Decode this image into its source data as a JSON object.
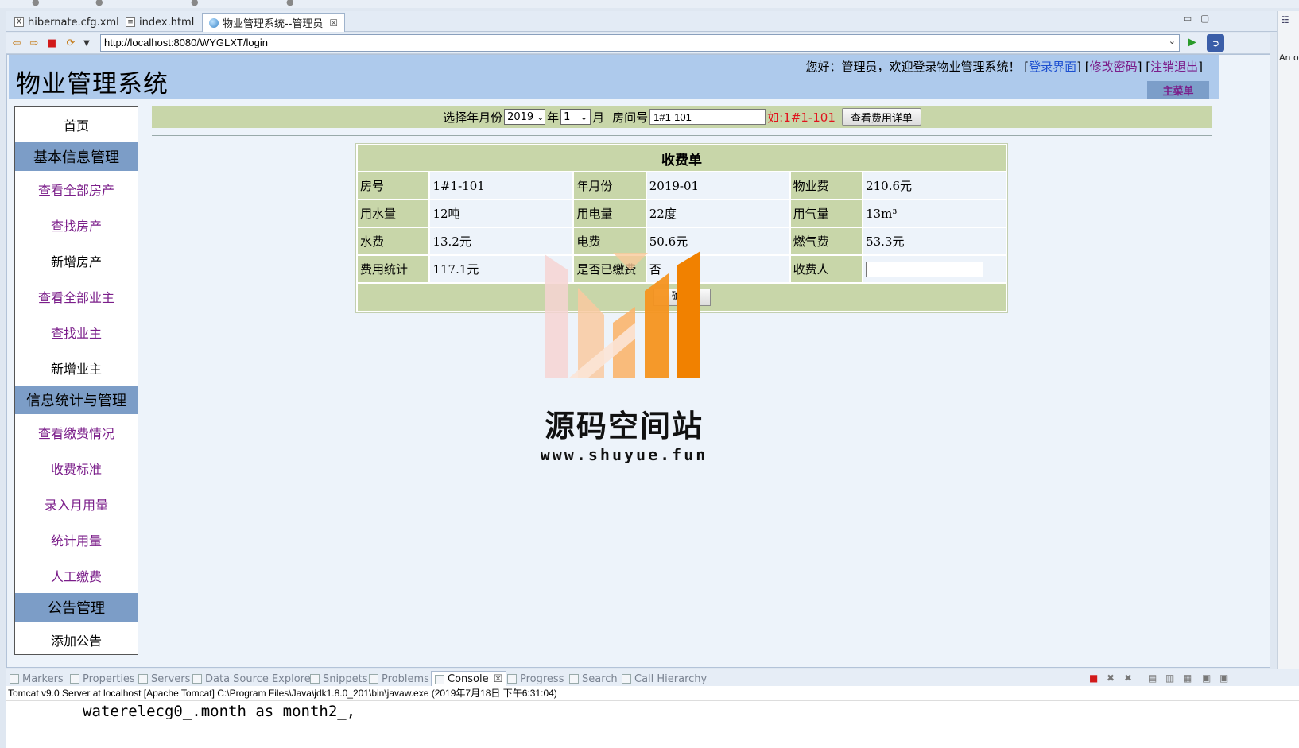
{
  "ide": {
    "editor_tabs": [
      {
        "label": "hibernate.cfg.xml",
        "icon": "xml-file-icon"
      },
      {
        "label": "index.html",
        "icon": "html-file-icon"
      },
      {
        "label": "物业管理系统--管理员",
        "icon": "globe-icon",
        "active": true
      }
    ],
    "right_gutter_text": "An o",
    "bottom_tabs": [
      {
        "label": "Markers"
      },
      {
        "label": "Properties"
      },
      {
        "label": "Servers"
      },
      {
        "label": "Data Source Explorer"
      },
      {
        "label": "Snippets"
      },
      {
        "label": "Problems"
      },
      {
        "label": "Console",
        "active": true
      },
      {
        "label": "Progress"
      },
      {
        "label": "Search"
      },
      {
        "label": "Call Hierarchy"
      }
    ],
    "console_status": "Tomcat v9.0 Server at localhost [Apache Tomcat] C:\\Program Files\\Java\\jdk1.8.0_201\\bin\\javaw.exe (2019年7月18日 下午6:31:04)",
    "console_line": "waterelecg0_.month as month2_,"
  },
  "browser": {
    "url": "http://localhost:8080/WYGLXT/login"
  },
  "site": {
    "title": "物业管理系统",
    "welcome": "您好：管理员，欢迎登录物业管理系统！",
    "links": {
      "login_page": "登录界面",
      "change_password": "修改密码",
      "logout": "注销退出"
    },
    "main_menu": "主菜单"
  },
  "sidebar": {
    "home": "首页",
    "sections": [
      {
        "header": "基本信息管理",
        "items": [
          "查看全部房产",
          "查找房产",
          "新增房产",
          "查看全部业主",
          "查找业主",
          "新增业主"
        ]
      },
      {
        "header": "信息统计与管理",
        "items": [
          "查看缴费情况",
          "收费标准",
          "录入月用量",
          "统计用量",
          "人工缴费"
        ]
      },
      {
        "header": "公告管理",
        "items": [
          "添加公告"
        ]
      }
    ]
  },
  "filter": {
    "label_select": "选择年月份",
    "year_value": "2019",
    "year_suffix": "年",
    "month_value": "1",
    "month_suffix": "月",
    "room_label": "房间号",
    "room_value": "1#1-101",
    "hint": "如:1#1-101",
    "detail_button": "查看费用详单"
  },
  "bill": {
    "title": "收费单",
    "rows": [
      [
        {
          "label": "房号",
          "value": "1#1-101"
        },
        {
          "label": "年月份",
          "value": "2019-01"
        },
        {
          "label": "物业费",
          "value": "210.6元"
        }
      ],
      [
        {
          "label": "用水量",
          "value": "12吨"
        },
        {
          "label": "用电量",
          "value": "22度"
        },
        {
          "label": "用气量",
          "value": "13m³"
        }
      ],
      [
        {
          "label": "水费",
          "value": "13.2元"
        },
        {
          "label": "电费",
          "value": "50.6元"
        },
        {
          "label": "燃气费",
          "value": "53.3元"
        }
      ],
      [
        {
          "label": "费用统计",
          "value": "117.1元"
        },
        {
          "label": "是否已缴费",
          "value": "否"
        },
        {
          "label": "收费人",
          "value": ""
        }
      ]
    ],
    "confirm_button": "确认"
  },
  "watermark": {
    "brand": "源码空间站",
    "url": "www.shuyue.fun",
    "colors": [
      "#f6d4d2",
      "#f9b56d",
      "#f6931f",
      "#f18100"
    ]
  },
  "colors": {
    "header_blue": "#aecaec",
    "sidebar_header": "#7c9dc7",
    "table_green": "#c8d6a9",
    "link_purple": "#7b1e8a",
    "hint_red": "#e0141e"
  }
}
